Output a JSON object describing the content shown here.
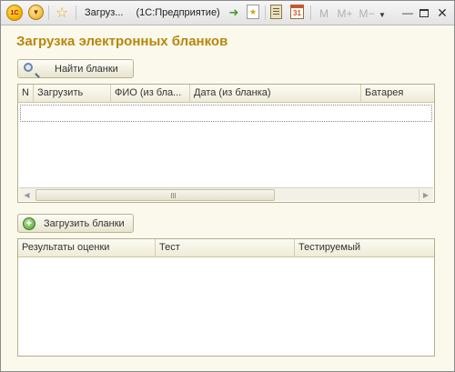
{
  "window": {
    "title": "Загруз...",
    "app_name": "(1С:Предприятие)",
    "app_logo_text": "1С",
    "toolbar_icons": [
      "menu-icon",
      "star-icon",
      "go-icon",
      "favorites-icon",
      "calculator-icon",
      "calendar-icon",
      "dropdown-icon"
    ],
    "memory_buttons": [
      "M",
      "M+",
      "M−"
    ],
    "calendar_day": "31",
    "minimize_glyph": "—",
    "close_glyph": "✕"
  },
  "page": {
    "title": "Загрузка электронных бланков"
  },
  "find_button": {
    "label": "Найти бланки"
  },
  "blanks_table": {
    "columns": [
      "N",
      "Загрузить",
      "ФИО (из бла...",
      "Дата (из бланка)",
      "Батарея"
    ],
    "rows": []
  },
  "load_button": {
    "label": "Загрузить бланки",
    "icon_glyph": "+"
  },
  "results_table": {
    "columns": [
      "Результаты оценки",
      "Тест",
      "Тестируемый"
    ],
    "rows": []
  },
  "colors": {
    "title": "#b8860b",
    "form_background": "#fbf9ec",
    "header_background": "#efebd7"
  }
}
